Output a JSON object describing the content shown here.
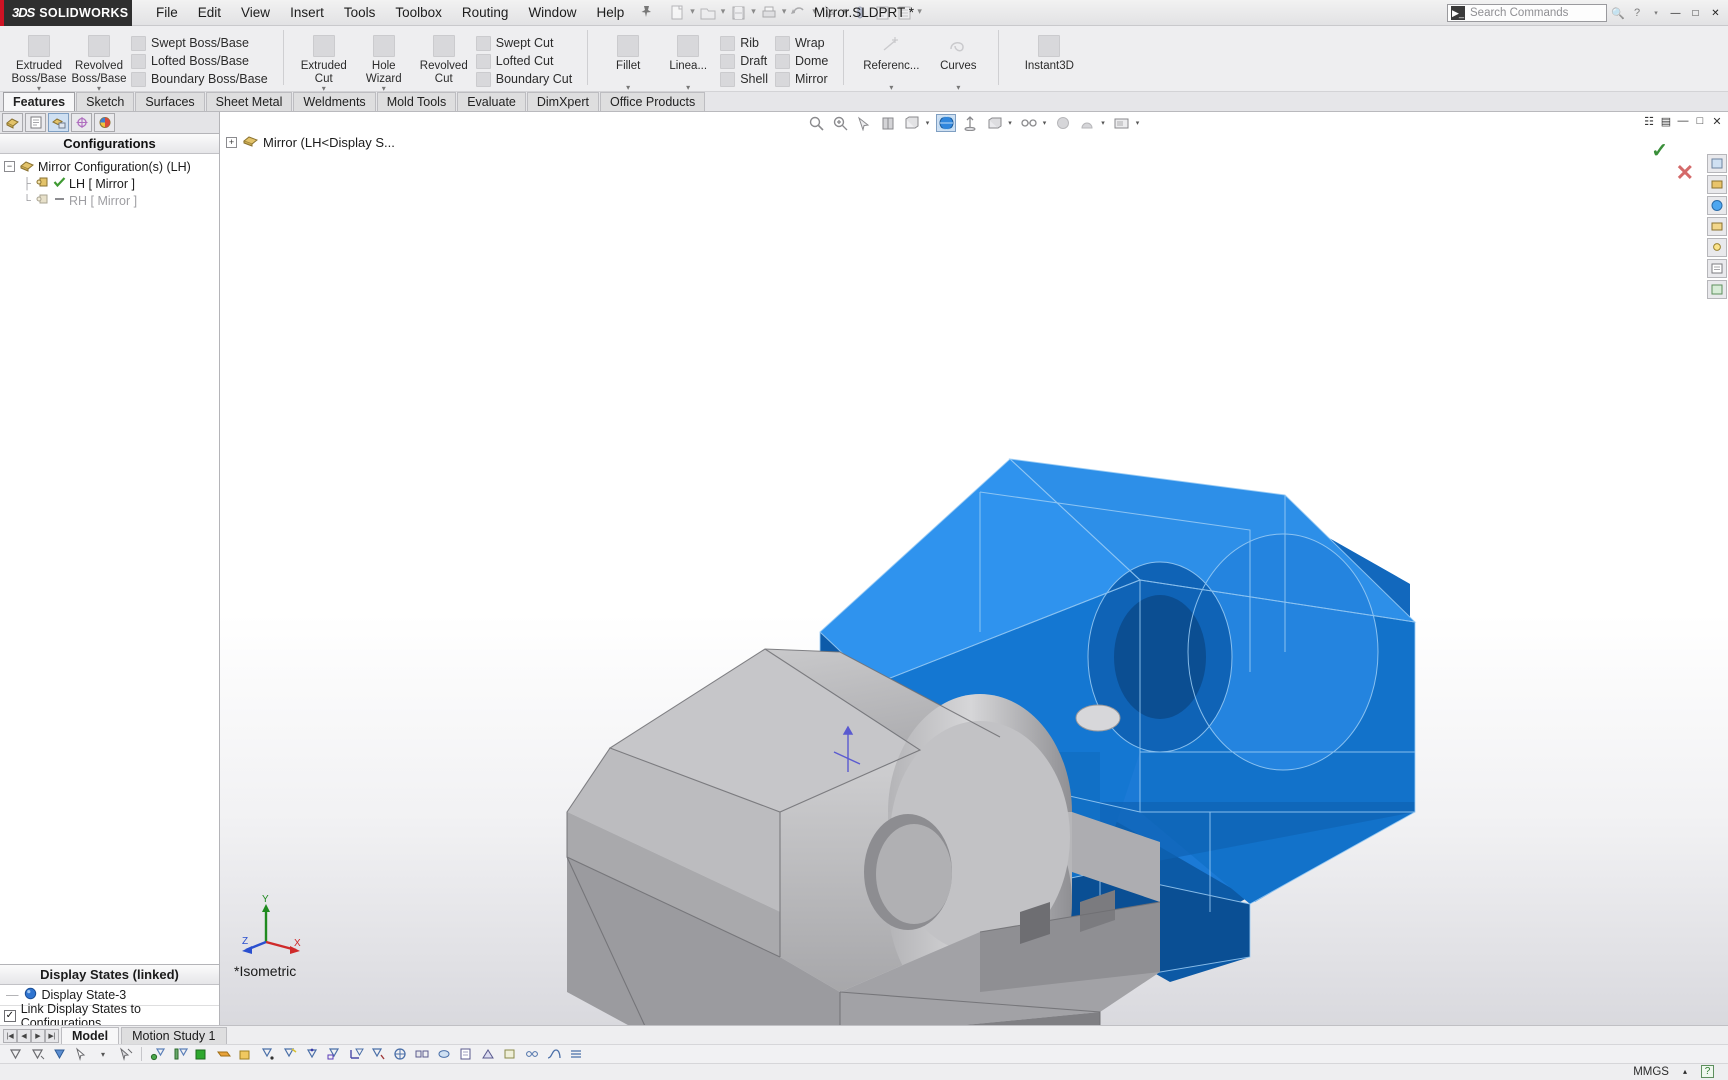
{
  "titlebar": {
    "brand_ds": "3DS",
    "brand_name": "SOLIDWORKS",
    "menus": [
      "File",
      "Edit",
      "View",
      "Insert",
      "Tools",
      "Toolbox",
      "Routing",
      "Window",
      "Help"
    ],
    "pin_icon": "pushpin-icon",
    "document_title": "Mirror.SLDPRT *",
    "quick_tools": [
      "new-document-icon",
      "open-document-icon",
      "save-icon",
      "print-icon",
      "undo-icon",
      "select-icon",
      "rebuild-icon",
      "file-properties-icon",
      "options-icon"
    ],
    "search": {
      "placeholder": "Search Commands",
      "icon": "search-commands-icon"
    },
    "help_icon": "help-icon",
    "window_buttons": [
      "minimize-icon",
      "restore-icon",
      "close-icon"
    ]
  },
  "ribbon": {
    "groups": [
      {
        "big": [
          {
            "label_line1": "Extruded",
            "label_line2": "Boss/Base",
            "icon": "extruded-boss-icon",
            "caret": true
          },
          {
            "label_line1": "Revolved",
            "label_line2": "Boss/Base",
            "icon": "revolved-boss-icon",
            "caret": true
          }
        ],
        "small": [
          {
            "label": "Swept Boss/Base",
            "icon": "swept-boss-icon"
          },
          {
            "label": "Lofted Boss/Base",
            "icon": "lofted-boss-icon"
          },
          {
            "label": "Boundary Boss/Base",
            "icon": "boundary-boss-icon"
          }
        ]
      },
      {
        "big": [
          {
            "label_line1": "Extruded",
            "label_line2": "Cut",
            "icon": "extruded-cut-icon",
            "caret": true
          },
          {
            "label_line1": "Hole",
            "label_line2": "Wizard",
            "icon": "hole-wizard-icon",
            "caret": true
          },
          {
            "label_line1": "Revolved",
            "label_line2": "Cut",
            "icon": "revolved-cut-icon",
            "caret": false
          }
        ],
        "small": [
          {
            "label": "Swept Cut",
            "icon": "swept-cut-icon"
          },
          {
            "label": "Lofted Cut",
            "icon": "lofted-cut-icon"
          },
          {
            "label": "Boundary Cut",
            "icon": "boundary-cut-icon"
          }
        ]
      },
      {
        "big": [
          {
            "label_line1": "Fillet",
            "label_line2": "",
            "icon": "fillet-icon",
            "caret": true
          },
          {
            "label_line1": "Linea...",
            "label_line2": "",
            "icon": "linear-pattern-icon",
            "caret": true
          }
        ],
        "small": [
          {
            "label": "Rib",
            "icon": "rib-icon"
          },
          {
            "label": "Draft",
            "icon": "draft-icon"
          },
          {
            "label": "Shell",
            "icon": "shell-icon"
          }
        ],
        "small2": [
          {
            "label": "Wrap",
            "icon": "wrap-icon"
          },
          {
            "label": "Dome",
            "icon": "dome-icon"
          },
          {
            "label": "Mirror",
            "icon": "mirror-icon"
          }
        ]
      },
      {
        "big": [
          {
            "label_line1": "Referenc...",
            "label_line2": "",
            "icon": "reference-geometry-icon",
            "caret": true
          },
          {
            "label_line1": "Curves",
            "label_line2": "",
            "icon": "curves-icon",
            "caret": true
          }
        ],
        "small": []
      },
      {
        "big": [
          {
            "label_line1": "Instant3D",
            "label_line2": "",
            "icon": "instant3d-icon",
            "caret": false
          }
        ],
        "small": []
      }
    ]
  },
  "command_tabs": {
    "active": "Features",
    "items": [
      "Features",
      "Sketch",
      "Surfaces",
      "Sheet Metal",
      "Weldments",
      "Mold Tools",
      "Evaluate",
      "DimXpert",
      "Office Products"
    ]
  },
  "left_panel": {
    "manager_tabs": [
      {
        "name": "feature-manager-tab",
        "selected": false
      },
      {
        "name": "property-manager-tab",
        "selected": false
      },
      {
        "name": "configuration-manager-tab",
        "selected": true
      },
      {
        "name": "dimxpert-manager-tab",
        "selected": false
      },
      {
        "name": "display-manager-tab",
        "selected": false
      }
    ],
    "header": "Configurations",
    "tree": [
      {
        "label": "Mirror Configuration(s)  (LH)",
        "level": 0,
        "expanded": true,
        "icon": "configurations-root-icon",
        "dim": false,
        "check": "none"
      },
      {
        "label": "LH [ Mirror ]",
        "level": 1,
        "expanded": false,
        "icon": "configuration-icon",
        "dim": false,
        "check": "active"
      },
      {
        "label": "RH [ Mirror ]",
        "level": 1,
        "expanded": false,
        "icon": "configuration-icon",
        "dim": true,
        "check": "inactive"
      }
    ],
    "display_states": {
      "header": "Display States (linked)",
      "state_label": "Display State-3",
      "link_checkbox_label": "Link Display States to Configurations",
      "link_checked": true
    }
  },
  "viewport": {
    "tree_label": "Mirror  (LH<Display S...",
    "tree_icon": "part-icon",
    "view_orientation": "*Isometric",
    "toolbar": [
      {
        "name": "zoom-to-fit-icon",
        "active": false,
        "caret": false
      },
      {
        "name": "zoom-to-area-icon",
        "active": false,
        "caret": false
      },
      {
        "name": "previous-view-icon",
        "active": false,
        "caret": false
      },
      {
        "name": "section-view-icon",
        "active": false,
        "caret": false
      },
      {
        "name": "view-orientation-icon",
        "active": false,
        "caret": true
      },
      {
        "name": "display-style-icon",
        "active": true,
        "caret": false
      },
      {
        "name": "hide-show-items-icon",
        "active": false,
        "caret": false
      },
      {
        "name": "apply-scene-icon",
        "active": false,
        "caret": true
      },
      {
        "name": "view-settings-icon",
        "active": false,
        "caret": true
      },
      {
        "name": "sphere-light-icon",
        "active": false,
        "caret": false
      },
      {
        "name": "shadow-icon",
        "active": false,
        "caret": true
      },
      {
        "name": "screen-capture-icon",
        "active": false,
        "caret": true
      }
    ],
    "confirm_icon": "ok-checkmark-icon",
    "cancel_icon": "cancel-x-icon",
    "right_toolbar": [
      "view-palette-icon",
      "appearances-icon",
      "scenes-icon",
      "lights-icon",
      "decals-icon",
      "custom-properties-icon",
      "design-library-icon"
    ],
    "triad": {
      "x": "X",
      "y": "Y",
      "z": "Z"
    },
    "window_controls": [
      "restore-down-icon",
      "minimize-icon",
      "maximize-icon",
      "close-icon"
    ]
  },
  "bottom": {
    "nav_buttons": [
      "first-tab-icon",
      "prev-tab-icon",
      "next-tab-icon",
      "last-tab-icon"
    ],
    "tabs": [
      {
        "label": "Model",
        "active": true
      },
      {
        "label": "Motion Study 1",
        "active": false
      }
    ],
    "status_icons": [
      "filter-faces-icon",
      "filter-edges-icon",
      "filter-vertices-icon",
      "select-arrow-icon",
      "select-dropdown-icon",
      "clear-filters-icon",
      "point-filter-icon",
      "axis-filter-icon",
      "surface-filter-icon",
      "plane-filter-icon",
      "solid-filter-icon",
      "sketch-filter-icon",
      "sketch-point-filter-icon",
      "dimension-filter-icon",
      "midpoint-filter-icon",
      "annotation-filter-icon",
      "weld-filter-icon",
      "center-mark-filter-icon",
      "datum-filter-icon",
      "hole-filter-icon",
      "note-filter-icon",
      "weldment-filter-icon",
      "block-filter-icon",
      "connection-filter-icon",
      "route-filter-icon",
      "cosmetic-thread-filter-icon"
    ],
    "units": "MMGS",
    "units_caret": "units-caret-icon",
    "help_badge": "help-question-icon"
  }
}
